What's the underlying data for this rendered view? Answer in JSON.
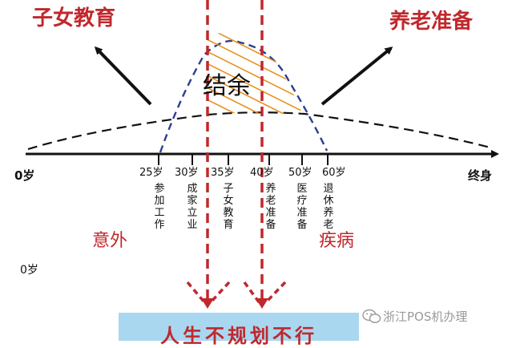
{
  "title_left": "子女教育",
  "title_right": "养老准备",
  "surplus_label": "结余",
  "accident_label": "意外",
  "illness_label": "疾病",
  "axis_start": "0岁",
  "axis_end": "终身",
  "bottom_left_label": "0岁",
  "ages": [
    "25岁",
    "30岁",
    "35岁",
    "40岁",
    "50岁",
    "60岁"
  ],
  "stages": [
    "参加工作",
    "成家立业",
    "子女教育",
    "养老准备",
    "医疗准备",
    "退休养老"
  ],
  "banner": "人生不规划不行",
  "watermark": "浙江POS机办理",
  "colors": {
    "red": "#c0282c",
    "blue_dash": "#2b3f8f",
    "hatch": "#e8901e",
    "banner_bg": "#a9d7ef"
  }
}
